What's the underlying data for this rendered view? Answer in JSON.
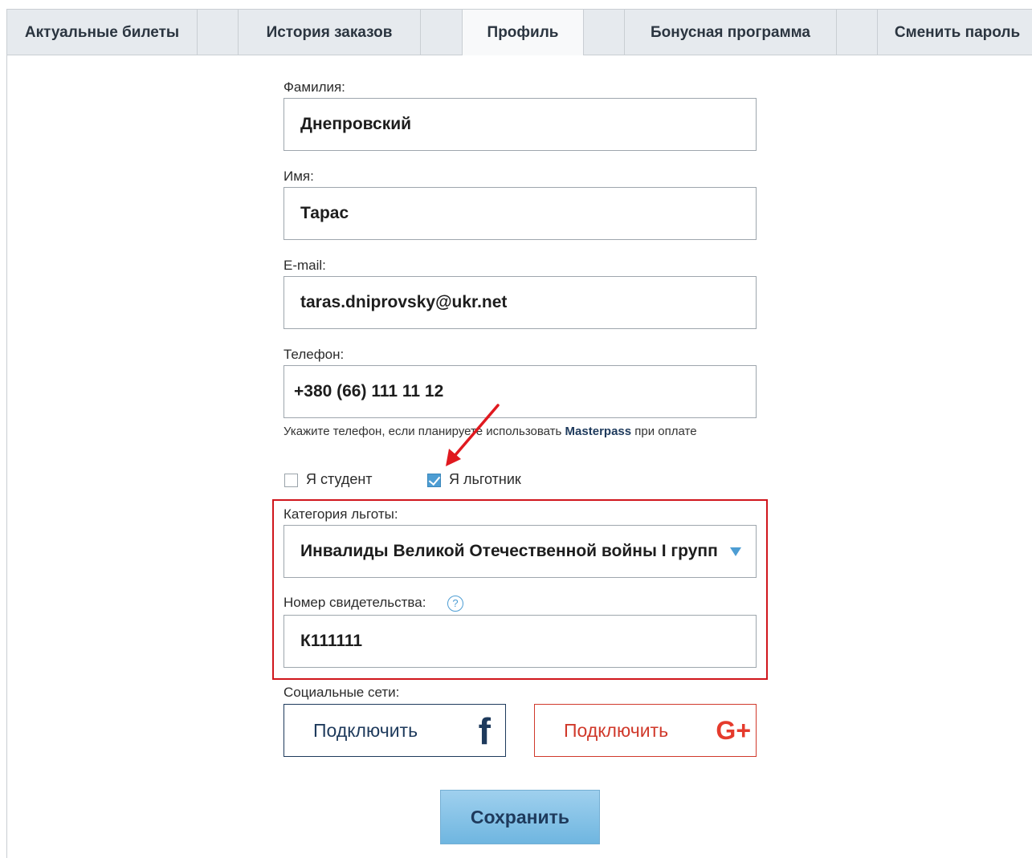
{
  "tabs": [
    {
      "label": "Актуальные билеты",
      "active": false
    },
    {
      "label": "История заказов",
      "active": false
    },
    {
      "label": "Профиль",
      "active": true
    },
    {
      "label": "Бонусная программа",
      "active": false
    },
    {
      "label": "Сменить пароль",
      "active": false
    }
  ],
  "form": {
    "surname": {
      "label": "Фамилия:",
      "value": "Днепровский"
    },
    "name": {
      "label": "Имя:",
      "value": "Тарас"
    },
    "email": {
      "label": "E-mail:",
      "value": "taras.dniprovsky@ukr.net"
    },
    "phone": {
      "label": "Телефон:",
      "value": "+380 (66) 111 11 12"
    },
    "phone_hint": {
      "before": "Укажите телефон, если планируете использовать ",
      "bold": "Masterpass",
      "after": " при оплате"
    },
    "student": {
      "label": "Я студент",
      "checked": false
    },
    "privileged": {
      "label": "Я льготник",
      "checked": true
    },
    "category": {
      "label": "Категория льготы:",
      "value": "Инвалиды Великой Отечественной войны I группы"
    },
    "certificate": {
      "label": "Номер свидетельства:",
      "value": "К111111",
      "help": "?"
    },
    "social": {
      "label": "Социальные сети:",
      "facebook": {
        "text": "Подключить",
        "icon": "f"
      },
      "google": {
        "text": "Подключить",
        "icon": "G+"
      }
    },
    "save_label": "Сохранить"
  },
  "colors": {
    "accent": "#4d9dd3",
    "highlight": "#d0161c",
    "facebook": "#1e3a5c",
    "google": "#d0392b"
  }
}
